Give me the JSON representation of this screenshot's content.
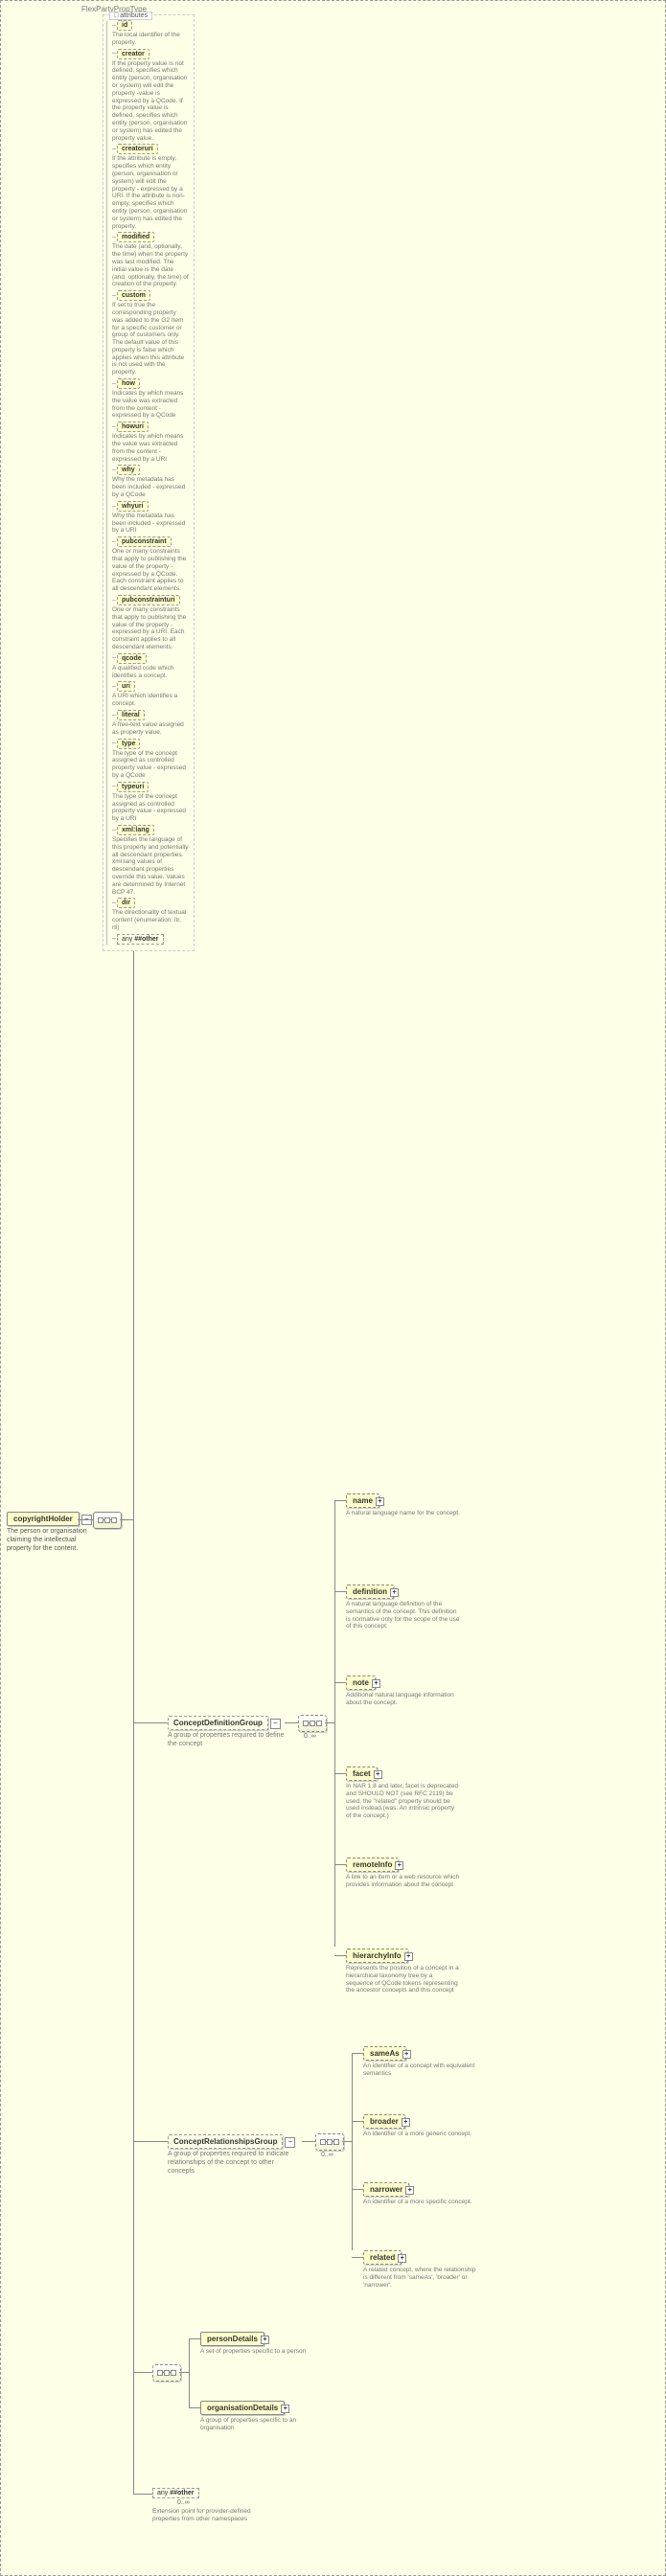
{
  "typeLabel": "FlexPartyPropType",
  "root": {
    "name": "copyrightHolder",
    "desc": "The person or organisation claiming the intellectual property for the content."
  },
  "attributesHeader": "attributes",
  "attributes": [
    {
      "name": "id",
      "desc": "The local identifier of the property."
    },
    {
      "name": "creator",
      "desc": "If the property value is not defined, specifies which entity (person, organisation or system) will edit the property -value is expressed by a QCode. If the property value is defined, specifies which entity (person, organisation or system) has edited the property value."
    },
    {
      "name": "creatoruri",
      "desc": "If the attribute is empty, specifies which entity (person, organisation or system) will edit the property - expressed by a URI. If the attribute is non-empty, specifies which entity (person, organisation or system) has edited the property."
    },
    {
      "name": "modified",
      "desc": "The date (and, optionally, the time) when the property was last modified. The initial value is the date (and, optionally, the time) of creation of the property."
    },
    {
      "name": "custom",
      "desc": "If set to true the corresponding property was added to the G2 Item for a specific customer or group of customers only. The default value of this property is false which applies when this attribute is not used with the property."
    },
    {
      "name": "how",
      "desc": "Indicates by which means the value was extracted from the content - expressed by a QCode"
    },
    {
      "name": "howuri",
      "desc": "Indicates by which means the value was extracted from the content - expressed by a URI"
    },
    {
      "name": "why",
      "desc": "Why the metadata has been included - expressed by a QCode"
    },
    {
      "name": "whyuri",
      "desc": "Why the metadata has been included - expressed by a URI"
    },
    {
      "name": "pubconstraint",
      "desc": "One or many constraints that apply to publishing the value of the property - expressed by a QCode. Each constraint applies to all descendant elements."
    },
    {
      "name": "pubconstrainturi",
      "desc": "One or many constraints that apply to publishing the value of the property - expressed by a URI. Each constraint applies to all descendant elements."
    },
    {
      "name": "qcode",
      "desc": "A qualified code which identifies a concept."
    },
    {
      "name": "uri",
      "desc": "A URI which identifies a concept."
    },
    {
      "name": "literal",
      "desc": "A free-text value assigned as property value."
    },
    {
      "name": "type",
      "desc": "The type of the concept assigned as controlled property value - expressed by a QCode"
    },
    {
      "name": "typeuri",
      "desc": "The type of the concept assigned as controlled property value - expressed by a URI"
    },
    {
      "name": "xml:lang",
      "desc": "Specifies the language of this property and potentially all descendant properties. xml:lang values of descendant properties override this value. Values are determined by Internet BCP 47."
    },
    {
      "name": "dir",
      "desc": "The directionality of textual content (enumeration: ltr, rtl)"
    }
  ],
  "any1": {
    "prefix": "any",
    "ns": "##other"
  },
  "groups": {
    "cdg": {
      "name": "ConceptDefinitionGroup",
      "desc": "A group of properties required to define the concept"
    },
    "crg": {
      "name": "ConceptRelationshipsGroup",
      "desc": "A group of properties required to indicate relationships of the concept to other concepts"
    }
  },
  "cdg_occ": "0..∞",
  "crg_occ": "0..∞",
  "leaves_cdg": [
    {
      "name": "name",
      "desc": "A natural language name for the concept.",
      "opt": true,
      "plus": true
    },
    {
      "name": "definition",
      "desc": "A natural language definition of the semantics of the concept. This definition is normative only for the scope of the use of this concept.",
      "opt": true,
      "plus": true
    },
    {
      "name": "note",
      "desc": "Additional natural language information about the concept.",
      "opt": true,
      "plus": true
    },
    {
      "name": "facet",
      "desc": "In NAR 1.8 and later, facet is deprecated and SHOULD NOT (see RFC 2119) be used, the \"related\" property should be used instead.(was: An intrinsic property of the concept.)",
      "opt": true,
      "plus": true
    },
    {
      "name": "remoteInfo",
      "desc": "A link to an item or a web resource which provides information about the concept",
      "opt": true,
      "plus": true
    },
    {
      "name": "hierarchyInfo",
      "desc": "Represents the position of a concept in a hierarchical taxonomy tree by a sequence of QCode tokens representing the ancestor concepts and this concept",
      "opt": true,
      "plus": true
    }
  ],
  "leaves_crg": [
    {
      "name": "sameAs",
      "desc": "An identifier of a concept with equivalent semantics",
      "opt": true,
      "plus": true
    },
    {
      "name": "broader",
      "desc": "An identifier of a more generic concept.",
      "opt": true,
      "plus": true
    },
    {
      "name": "narrower",
      "desc": "An identifier of a more specific concept.",
      "opt": true,
      "plus": true
    },
    {
      "name": "related",
      "desc": "A related concept, where the relationship is different from 'sameAs', 'broader' or 'narrower'.",
      "opt": true,
      "plus": true
    }
  ],
  "choice": [
    {
      "name": "personDetails",
      "desc": "A set of properties specific to a person",
      "plus": true
    },
    {
      "name": "organisationDetails",
      "desc": "A group of properties specific to an organisation",
      "plus": true
    }
  ],
  "any2": {
    "prefix": "any",
    "ns": "##other",
    "occ": "0..∞",
    "desc": "Extension point for provider-defined properties from other namespaces"
  }
}
